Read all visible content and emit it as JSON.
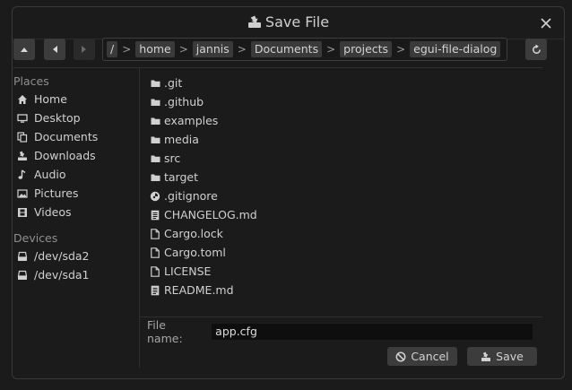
{
  "window": {
    "title": "Save File"
  },
  "toolbar": {
    "path_segments": [
      "/",
      "home",
      "jannis",
      "Documents",
      "projects",
      "egui-file-dialog"
    ],
    "separator": ">"
  },
  "sidebar": {
    "places_label": "Places",
    "places": [
      {
        "label": "Home",
        "icon": "home-icon"
      },
      {
        "label": "Desktop",
        "icon": "desktop-icon"
      },
      {
        "label": "Documents",
        "icon": "documents-icon"
      },
      {
        "label": "Downloads",
        "icon": "downloads-icon"
      },
      {
        "label": "Audio",
        "icon": "music-note-icon"
      },
      {
        "label": "Pictures",
        "icon": "picture-icon"
      },
      {
        "label": "Videos",
        "icon": "film-icon"
      }
    ],
    "devices_label": "Devices",
    "devices": [
      {
        "label": "/dev/sda2",
        "icon": "drive-icon"
      },
      {
        "label": "/dev/sda1",
        "icon": "drive-icon"
      }
    ]
  },
  "files": [
    {
      "name": ".git",
      "type": "folder"
    },
    {
      "name": ".github",
      "type": "folder"
    },
    {
      "name": "examples",
      "type": "folder"
    },
    {
      "name": "media",
      "type": "folder"
    },
    {
      "name": "src",
      "type": "folder"
    },
    {
      "name": "target",
      "type": "folder"
    },
    {
      "name": ".gitignore",
      "type": "git"
    },
    {
      "name": "CHANGELOG.md",
      "type": "doc"
    },
    {
      "name": "Cargo.lock",
      "type": "file"
    },
    {
      "name": "Cargo.toml",
      "type": "file"
    },
    {
      "name": "LICENSE",
      "type": "file"
    },
    {
      "name": "README.md",
      "type": "doc"
    }
  ],
  "footer": {
    "file_name_label": "File name:",
    "file_name_value": "app.cfg",
    "cancel_label": "Cancel",
    "save_label": "Save"
  },
  "colors": {
    "background": "#1b1b1b",
    "button": "#3c3c3c",
    "text": "#d0d0d0"
  }
}
